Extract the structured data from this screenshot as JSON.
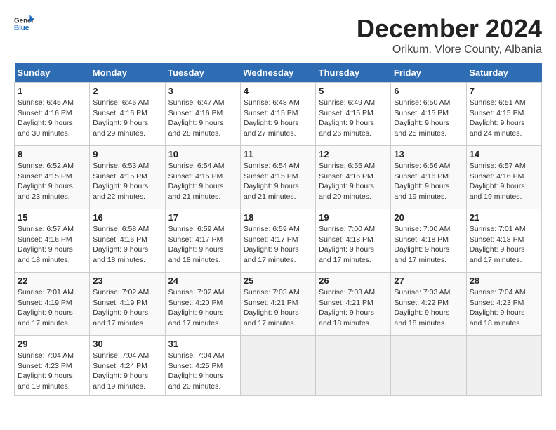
{
  "header": {
    "logo_general": "General",
    "logo_blue": "Blue",
    "month": "December 2024",
    "location": "Orikum, Vlore County, Albania"
  },
  "weekdays": [
    "Sunday",
    "Monday",
    "Tuesday",
    "Wednesday",
    "Thursday",
    "Friday",
    "Saturday"
  ],
  "weeks": [
    [
      {
        "day": "1",
        "sunrise": "Sunrise: 6:45 AM",
        "sunset": "Sunset: 4:16 PM",
        "daylight": "Daylight: 9 hours and 30 minutes."
      },
      {
        "day": "2",
        "sunrise": "Sunrise: 6:46 AM",
        "sunset": "Sunset: 4:16 PM",
        "daylight": "Daylight: 9 hours and 29 minutes."
      },
      {
        "day": "3",
        "sunrise": "Sunrise: 6:47 AM",
        "sunset": "Sunset: 4:16 PM",
        "daylight": "Daylight: 9 hours and 28 minutes."
      },
      {
        "day": "4",
        "sunrise": "Sunrise: 6:48 AM",
        "sunset": "Sunset: 4:15 PM",
        "daylight": "Daylight: 9 hours and 27 minutes."
      },
      {
        "day": "5",
        "sunrise": "Sunrise: 6:49 AM",
        "sunset": "Sunset: 4:15 PM",
        "daylight": "Daylight: 9 hours and 26 minutes."
      },
      {
        "day": "6",
        "sunrise": "Sunrise: 6:50 AM",
        "sunset": "Sunset: 4:15 PM",
        "daylight": "Daylight: 9 hours and 25 minutes."
      },
      {
        "day": "7",
        "sunrise": "Sunrise: 6:51 AM",
        "sunset": "Sunset: 4:15 PM",
        "daylight": "Daylight: 9 hours and 24 minutes."
      }
    ],
    [
      {
        "day": "8",
        "sunrise": "Sunrise: 6:52 AM",
        "sunset": "Sunset: 4:15 PM",
        "daylight": "Daylight: 9 hours and 23 minutes."
      },
      {
        "day": "9",
        "sunrise": "Sunrise: 6:53 AM",
        "sunset": "Sunset: 4:15 PM",
        "daylight": "Daylight: 9 hours and 22 minutes."
      },
      {
        "day": "10",
        "sunrise": "Sunrise: 6:54 AM",
        "sunset": "Sunset: 4:15 PM",
        "daylight": "Daylight: 9 hours and 21 minutes."
      },
      {
        "day": "11",
        "sunrise": "Sunrise: 6:54 AM",
        "sunset": "Sunset: 4:15 PM",
        "daylight": "Daylight: 9 hours and 21 minutes."
      },
      {
        "day": "12",
        "sunrise": "Sunrise: 6:55 AM",
        "sunset": "Sunset: 4:16 PM",
        "daylight": "Daylight: 9 hours and 20 minutes."
      },
      {
        "day": "13",
        "sunrise": "Sunrise: 6:56 AM",
        "sunset": "Sunset: 4:16 PM",
        "daylight": "Daylight: 9 hours and 19 minutes."
      },
      {
        "day": "14",
        "sunrise": "Sunrise: 6:57 AM",
        "sunset": "Sunset: 4:16 PM",
        "daylight": "Daylight: 9 hours and 19 minutes."
      }
    ],
    [
      {
        "day": "15",
        "sunrise": "Sunrise: 6:57 AM",
        "sunset": "Sunset: 4:16 PM",
        "daylight": "Daylight: 9 hours and 18 minutes."
      },
      {
        "day": "16",
        "sunrise": "Sunrise: 6:58 AM",
        "sunset": "Sunset: 4:16 PM",
        "daylight": "Daylight: 9 hours and 18 minutes."
      },
      {
        "day": "17",
        "sunrise": "Sunrise: 6:59 AM",
        "sunset": "Sunset: 4:17 PM",
        "daylight": "Daylight: 9 hours and 18 minutes."
      },
      {
        "day": "18",
        "sunrise": "Sunrise: 6:59 AM",
        "sunset": "Sunset: 4:17 PM",
        "daylight": "Daylight: 9 hours and 17 minutes."
      },
      {
        "day": "19",
        "sunrise": "Sunrise: 7:00 AM",
        "sunset": "Sunset: 4:18 PM",
        "daylight": "Daylight: 9 hours and 17 minutes."
      },
      {
        "day": "20",
        "sunrise": "Sunrise: 7:00 AM",
        "sunset": "Sunset: 4:18 PM",
        "daylight": "Daylight: 9 hours and 17 minutes."
      },
      {
        "day": "21",
        "sunrise": "Sunrise: 7:01 AM",
        "sunset": "Sunset: 4:18 PM",
        "daylight": "Daylight: 9 hours and 17 minutes."
      }
    ],
    [
      {
        "day": "22",
        "sunrise": "Sunrise: 7:01 AM",
        "sunset": "Sunset: 4:19 PM",
        "daylight": "Daylight: 9 hours and 17 minutes."
      },
      {
        "day": "23",
        "sunrise": "Sunrise: 7:02 AM",
        "sunset": "Sunset: 4:19 PM",
        "daylight": "Daylight: 9 hours and 17 minutes."
      },
      {
        "day": "24",
        "sunrise": "Sunrise: 7:02 AM",
        "sunset": "Sunset: 4:20 PM",
        "daylight": "Daylight: 9 hours and 17 minutes."
      },
      {
        "day": "25",
        "sunrise": "Sunrise: 7:03 AM",
        "sunset": "Sunset: 4:21 PM",
        "daylight": "Daylight: 9 hours and 17 minutes."
      },
      {
        "day": "26",
        "sunrise": "Sunrise: 7:03 AM",
        "sunset": "Sunset: 4:21 PM",
        "daylight": "Daylight: 9 hours and 18 minutes."
      },
      {
        "day": "27",
        "sunrise": "Sunrise: 7:03 AM",
        "sunset": "Sunset: 4:22 PM",
        "daylight": "Daylight: 9 hours and 18 minutes."
      },
      {
        "day": "28",
        "sunrise": "Sunrise: 7:04 AM",
        "sunset": "Sunset: 4:23 PM",
        "daylight": "Daylight: 9 hours and 18 minutes."
      }
    ],
    [
      {
        "day": "29",
        "sunrise": "Sunrise: 7:04 AM",
        "sunset": "Sunset: 4:23 PM",
        "daylight": "Daylight: 9 hours and 19 minutes."
      },
      {
        "day": "30",
        "sunrise": "Sunrise: 7:04 AM",
        "sunset": "Sunset: 4:24 PM",
        "daylight": "Daylight: 9 hours and 19 minutes."
      },
      {
        "day": "31",
        "sunrise": "Sunrise: 7:04 AM",
        "sunset": "Sunset: 4:25 PM",
        "daylight": "Daylight: 9 hours and 20 minutes."
      },
      null,
      null,
      null,
      null
    ]
  ]
}
